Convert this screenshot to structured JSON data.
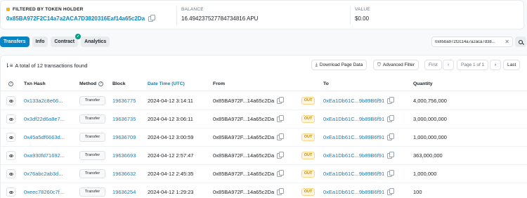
{
  "summary": {
    "filter_label": "FILTERED BY TOKEN HOLDER",
    "holder_address": "0x85BA972F2C14a7a2ACA7D3820316Eaf14a65c2Da",
    "balance_label": "BALANCE",
    "balance_value": "16.494237527784734816 APU",
    "value_label": "VALUE",
    "value_value": "$0.00"
  },
  "tabs": [
    "Transfers",
    "Info",
    "Contract",
    "Analytics"
  ],
  "search": {
    "value": "0x85ba972f2c14a7a2aca7d38..."
  },
  "toolbar": {
    "total_text": "A total of 12 transactions found",
    "download": "Download Page Data",
    "advanced_filter": "Advanced Filter",
    "first": "First",
    "page": "Page 1 of 1",
    "last": "Last"
  },
  "columns": {
    "txn_hash": "Txn Hash",
    "method": "Method",
    "block": "Block",
    "datetime": "Date Time (UTC)",
    "from": "From",
    "to": "To",
    "quantity": "Quantity"
  },
  "rows": [
    {
      "hash": "0x133a2c8e66...",
      "method": "Transfer",
      "block": "19636775",
      "time": "2024-04-12 3:14:11",
      "from": "0x85BA972F...14a65c2Da",
      "dir": "OUT",
      "to": "0xEa1Db61C...9b89B6f91",
      "qty": "4,000,756,000"
    },
    {
      "hash": "0x3df22d6a8e7...",
      "method": "Transfer",
      "block": "19636735",
      "time": "2024-04-12 3:06:11",
      "from": "0x85BA972F...14a65c2Da",
      "dir": "OUT",
      "to": "0xEa1Db61C...9b89B6f91",
      "qty": "3,000,000,000"
    },
    {
      "hash": "0x45a5df6663d...",
      "method": "Transfer",
      "block": "19636709",
      "time": "2024-04-12 3:00:59",
      "from": "0x85BA972F...14a65c2Da",
      "dir": "OUT",
      "to": "0xEa1Db61C...9b89B6f91",
      "qty": "1,000,000,000"
    },
    {
      "hash": "0xa930fd71692...",
      "method": "Transfer",
      "block": "19636693",
      "time": "2024-04-12 2:57:47",
      "from": "0x85BA972F...14a65c2Da",
      "dir": "OUT",
      "to": "0xEa1Db61C...9b89B6f91",
      "qty": "363,000,000"
    },
    {
      "hash": "0x76abc2ab3d...",
      "method": "Transfer",
      "block": "19636632",
      "time": "2024-04-12 2:45:35",
      "from": "0x85BA972F...14a65c2Da",
      "dir": "OUT",
      "to": "0xEa1Db61C...9b89B6f91",
      "qty": "1,000,000"
    },
    {
      "hash": "0xeec78260c7f...",
      "method": "Transfer",
      "block": "19636254",
      "time": "2024-04-12 1:29:23",
      "from": "0x85BA972F...14a65c2Da",
      "dir": "OUT",
      "to": "0xEa1Db61C...9b89B6f91",
      "qty": "100"
    }
  ],
  "colors": {
    "accent": "#0784c3",
    "out_badge": "#c98b00",
    "verified": "#00a186"
  }
}
